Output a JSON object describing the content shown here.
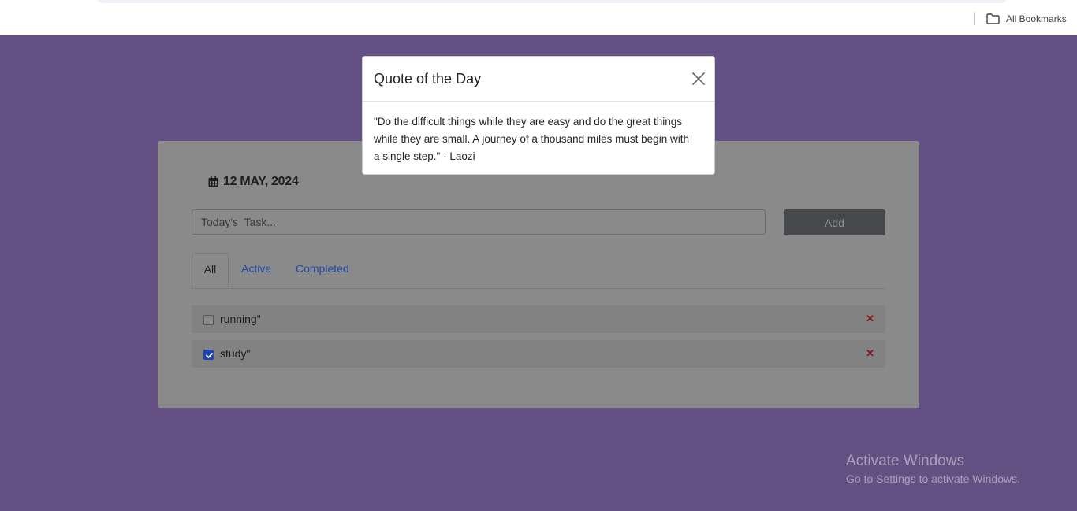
{
  "browser": {
    "bookmarks_label": "All Bookmarks"
  },
  "app": {
    "date": "12 MAY, 2024",
    "task_input": {
      "placeholder": "Today's  Task...",
      "value": ""
    },
    "add_label": "Add",
    "tabs": [
      {
        "label": "All",
        "active": true
      },
      {
        "label": "Active",
        "active": false
      },
      {
        "label": "Completed",
        "active": false
      }
    ],
    "todos": [
      {
        "label": "running\"",
        "checked": false,
        "delete_glyph": "✕"
      },
      {
        "label": "study\"",
        "checked": true,
        "delete_glyph": "✕"
      }
    ]
  },
  "modal": {
    "title": "Quote of the Day",
    "body": "\"Do the difficult things while they are easy and do the great things while they are small. A journey of a thousand miles must begin with a single step.\" - Laozi"
  },
  "watermark": {
    "title": "Activate Windows",
    "subtitle": "Go to Settings to activate Windows."
  },
  "colors": {
    "page_background": "#645083",
    "link_blue": "#1f4caa",
    "checkbox_blue": "#1a45b0",
    "delete_red": "#8c1313"
  },
  "icons": {
    "bookmarks": "folder-icon",
    "date": "calendar-icon",
    "close": "close-icon",
    "checkbox_checked": "checkmark-icon"
  }
}
